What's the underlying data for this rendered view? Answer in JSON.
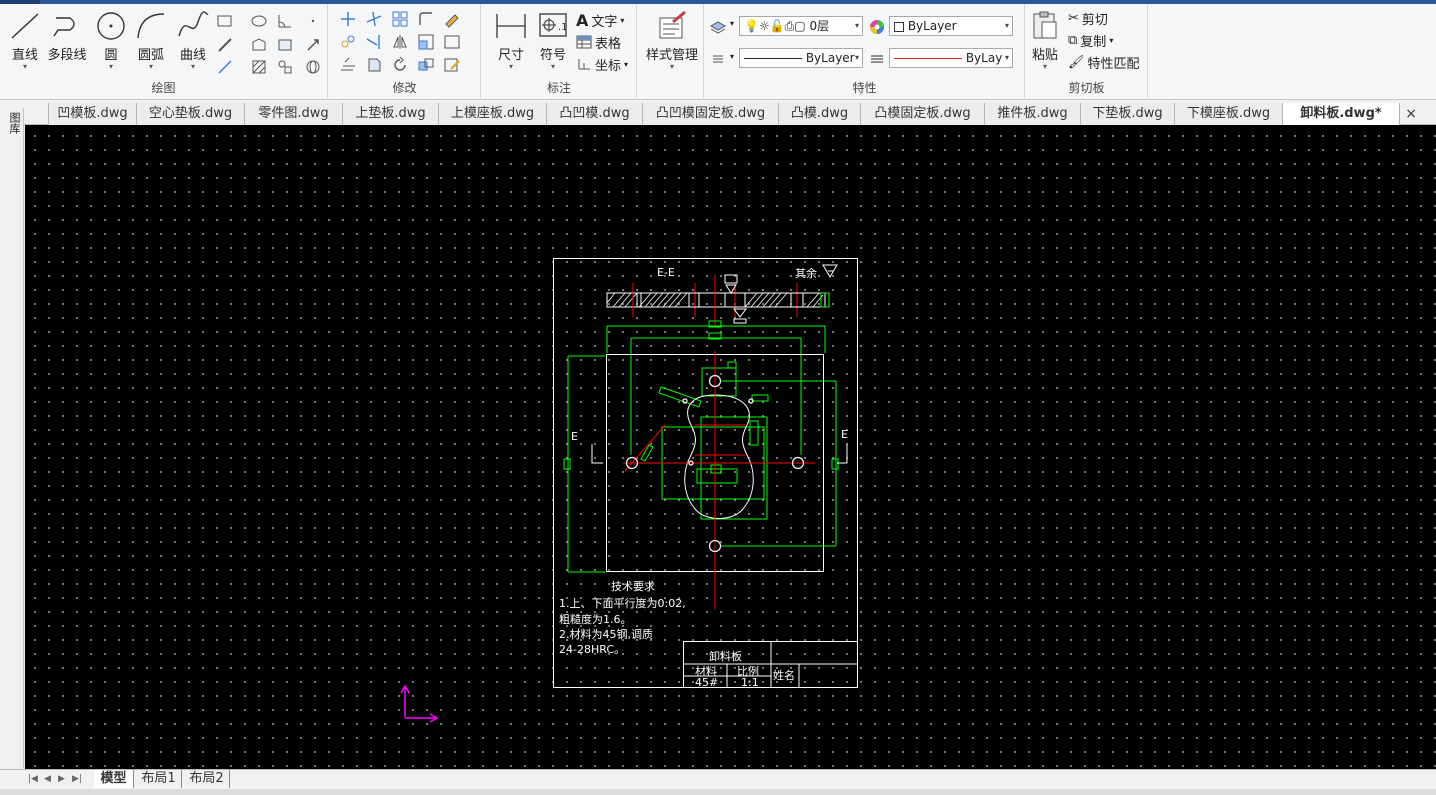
{
  "ribbon": {
    "draw": {
      "title": "绘图",
      "line": "直线",
      "polyline": "多段线",
      "circle": "圆",
      "arc": "圆弧",
      "curve": "曲线"
    },
    "modify": {
      "title": "修改"
    },
    "annotate": {
      "title": "标注",
      "dimension": "尺寸",
      "symbol": "符号",
      "text": "文字",
      "table": "表格",
      "coord": "坐标"
    },
    "style": {
      "title": "样式管理"
    },
    "properties": {
      "title": "特性",
      "layer_value": "0层",
      "color_value": "ByLayer",
      "linetype_value": "ByLayer",
      "lineweight_value": "ByLay­"
    },
    "clipboard": {
      "title": "剪切板",
      "paste": "粘贴",
      "cut": "剪切",
      "copy": "复制",
      "match": "特性匹配"
    }
  },
  "doc_tabs": [
    {
      "label": "凹模板.dwg"
    },
    {
      "label": "空心垫板.dwg"
    },
    {
      "label": "零件图.dwg"
    },
    {
      "label": "上垫板.dwg"
    },
    {
      "label": "上模座板.dwg"
    },
    {
      "label": "凸凹模.dwg"
    },
    {
      "label": "凸凹模固定板.dwg"
    },
    {
      "label": "凸模.dwg"
    },
    {
      "label": "凸模固定板.dwg"
    },
    {
      "label": "推件板.dwg"
    },
    {
      "label": "下垫板.dwg"
    },
    {
      "label": "下模座板.dwg"
    },
    {
      "label": "卸料板.dwg*",
      "active": true
    }
  ],
  "side_panel": {
    "label": "图库"
  },
  "drawing": {
    "section_label": "E-E",
    "surface_note": "其余",
    "side_label_left": "E",
    "side_label_right": "E",
    "tech_title": "技术要求",
    "tech_lines": [
      "1.上、下面平行度为0:02,",
      "粗糙度为1.6。",
      "2.材料为45钢,调质",
      "24-28HRC。"
    ],
    "title_block": {
      "part_name": "卸料板",
      "material_label": "材料",
      "scale_label": "比例",
      "name_label": "姓名",
      "material_value": "45#",
      "scale_value": "1:1"
    }
  },
  "bottom_tabs": [
    {
      "label": "模型",
      "active": true
    },
    {
      "label": "布局1"
    },
    {
      "label": "布局2"
    }
  ],
  "colors": {
    "accent": "#2b579a",
    "canvas": "#000000",
    "cad_green": "#00ff00",
    "cad_red": "#ff0000",
    "cad_white": "#ffffff",
    "ucs_magenta": "#ff00ff"
  }
}
